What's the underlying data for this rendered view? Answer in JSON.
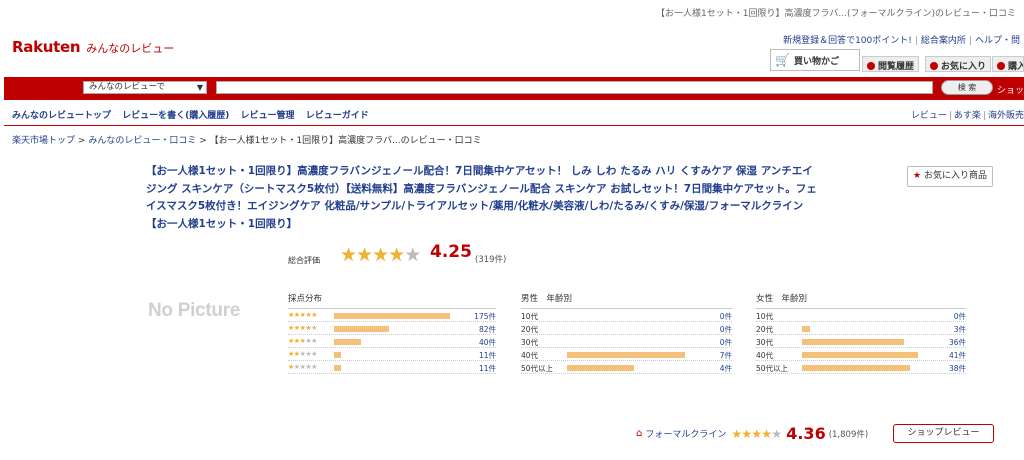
{
  "page": {
    "top_title": "【お一人様1セット・1回限り】高濃度フラバ...(フォーマルクライン)のレビュー・口コミ"
  },
  "header": {
    "brand": "Rakuten",
    "sub_brand": "みんなのレビュー",
    "util_links": [
      "新規登録＆回答で100ポイント!",
      "総合案内所",
      "ヘルプ・問"
    ],
    "cart_label": "買い物かご",
    "tabs": [
      "閲覧履歴",
      "お気に入り",
      "購入"
    ]
  },
  "search": {
    "select_value": "みんなのレビューで",
    "input_value": "",
    "button_label": "検 索",
    "shop_label": "ショップ"
  },
  "subnav": {
    "left": [
      "みんなのレビュートップ",
      "レビューを書く(購入履歴)",
      "レビュー管理",
      "レビューガイド"
    ],
    "right": [
      "レビュー",
      "あす楽",
      "海外販売"
    ]
  },
  "breadcrumb": {
    "items": [
      "楽天市場トップ",
      "みんなのレビュー・口コミ"
    ],
    "current": "【お一人様1セット・1回限り】高濃度フラバ...のレビュー・口コミ",
    "separator": ">"
  },
  "product": {
    "title": "【お一人様1セット・1回限り】高濃度フラバンジェノール配合！7日間集中ケアセット！ しみ しわ たるみ ハリ くすみケア 保湿 アンチエイジング スキンケア（シートマスク5枚付）【送料無料】高濃度フラバンジェノール配合 スキンケア お試しセット！7日間集中ケアセット。フェイスマスク5枚付き！エイジングケア 化粧品/サンプル/トライアルセット/薬用/化粧水/美容液/しわ/たるみ/くすみ/保湿/フォーマルクライン【お一人様1セット・1回限り】",
    "fav_button": "お気に入り商品",
    "no_picture": "No Picture"
  },
  "rating": {
    "label": "総合評価",
    "score": "4.25",
    "score_value": 4.25,
    "count": "(319件)"
  },
  "distribution": {
    "header": "採点分布",
    "rows": [
      {
        "stars": 5,
        "count": "175件",
        "fraction": 1.0
      },
      {
        "stars": 4,
        "count": "82件",
        "fraction": 0.47
      },
      {
        "stars": 3,
        "count": "40件",
        "fraction": 0.23
      },
      {
        "stars": 2,
        "count": "11件",
        "fraction": 0.06
      },
      {
        "stars": 1,
        "count": "11件",
        "fraction": 0.06
      }
    ]
  },
  "male": {
    "header": "男性　年齢別",
    "rows": [
      {
        "label": "10代",
        "count": "0件",
        "fraction": 0
      },
      {
        "label": "20代",
        "count": "0件",
        "fraction": 0
      },
      {
        "label": "30代",
        "count": "0件",
        "fraction": 0
      },
      {
        "label": "40代",
        "count": "7件",
        "fraction": 1.0
      },
      {
        "label": "50代以上",
        "count": "4件",
        "fraction": 0.57
      }
    ]
  },
  "female": {
    "header": "女性　年齢別",
    "rows": [
      {
        "label": "10代",
        "count": "0件",
        "fraction": 0
      },
      {
        "label": "20代",
        "count": "3件",
        "fraction": 0.07
      },
      {
        "label": "30代",
        "count": "36件",
        "fraction": 0.88
      },
      {
        "label": "40代",
        "count": "41件",
        "fraction": 1.0
      },
      {
        "label": "50代以上",
        "count": "38件",
        "fraction": 0.93
      }
    ]
  },
  "shop": {
    "name": "フォーマルクライン",
    "score": "4.36",
    "score_value": 4.36,
    "count": "(1,809件)",
    "review_button": "ショップレビュー"
  },
  "colors": {
    "brand_red": "#bf0000",
    "link_blue": "#23408e",
    "bar_orange": "#f4c17a",
    "star_gold": "#f0b030"
  }
}
